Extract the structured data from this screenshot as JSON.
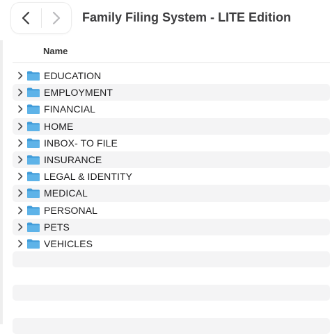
{
  "window": {
    "title": "Family Filing System - LITE Edition"
  },
  "navigation": {
    "back_icon": "chevron-left-icon",
    "forward_icon": "chevron-right-icon"
  },
  "columns": {
    "name": "Name"
  },
  "folders": [
    {
      "label": "EDUCATION"
    },
    {
      "label": "EMPLOYMENT"
    },
    {
      "label": "FINANCIAL"
    },
    {
      "label": "HOME"
    },
    {
      "label": "INBOX- TO FILE"
    },
    {
      "label": "INSURANCE"
    },
    {
      "label": "LEGAL & IDENTITY"
    },
    {
      "label": "MEDICAL"
    },
    {
      "label": "PERSONAL"
    },
    {
      "label": "PETS"
    },
    {
      "label": "VEHICLES"
    }
  ],
  "colors": {
    "folder": "#5eb3e8",
    "folder_tab": "#3f9bd9",
    "alt_row": "#f4f4f5"
  }
}
